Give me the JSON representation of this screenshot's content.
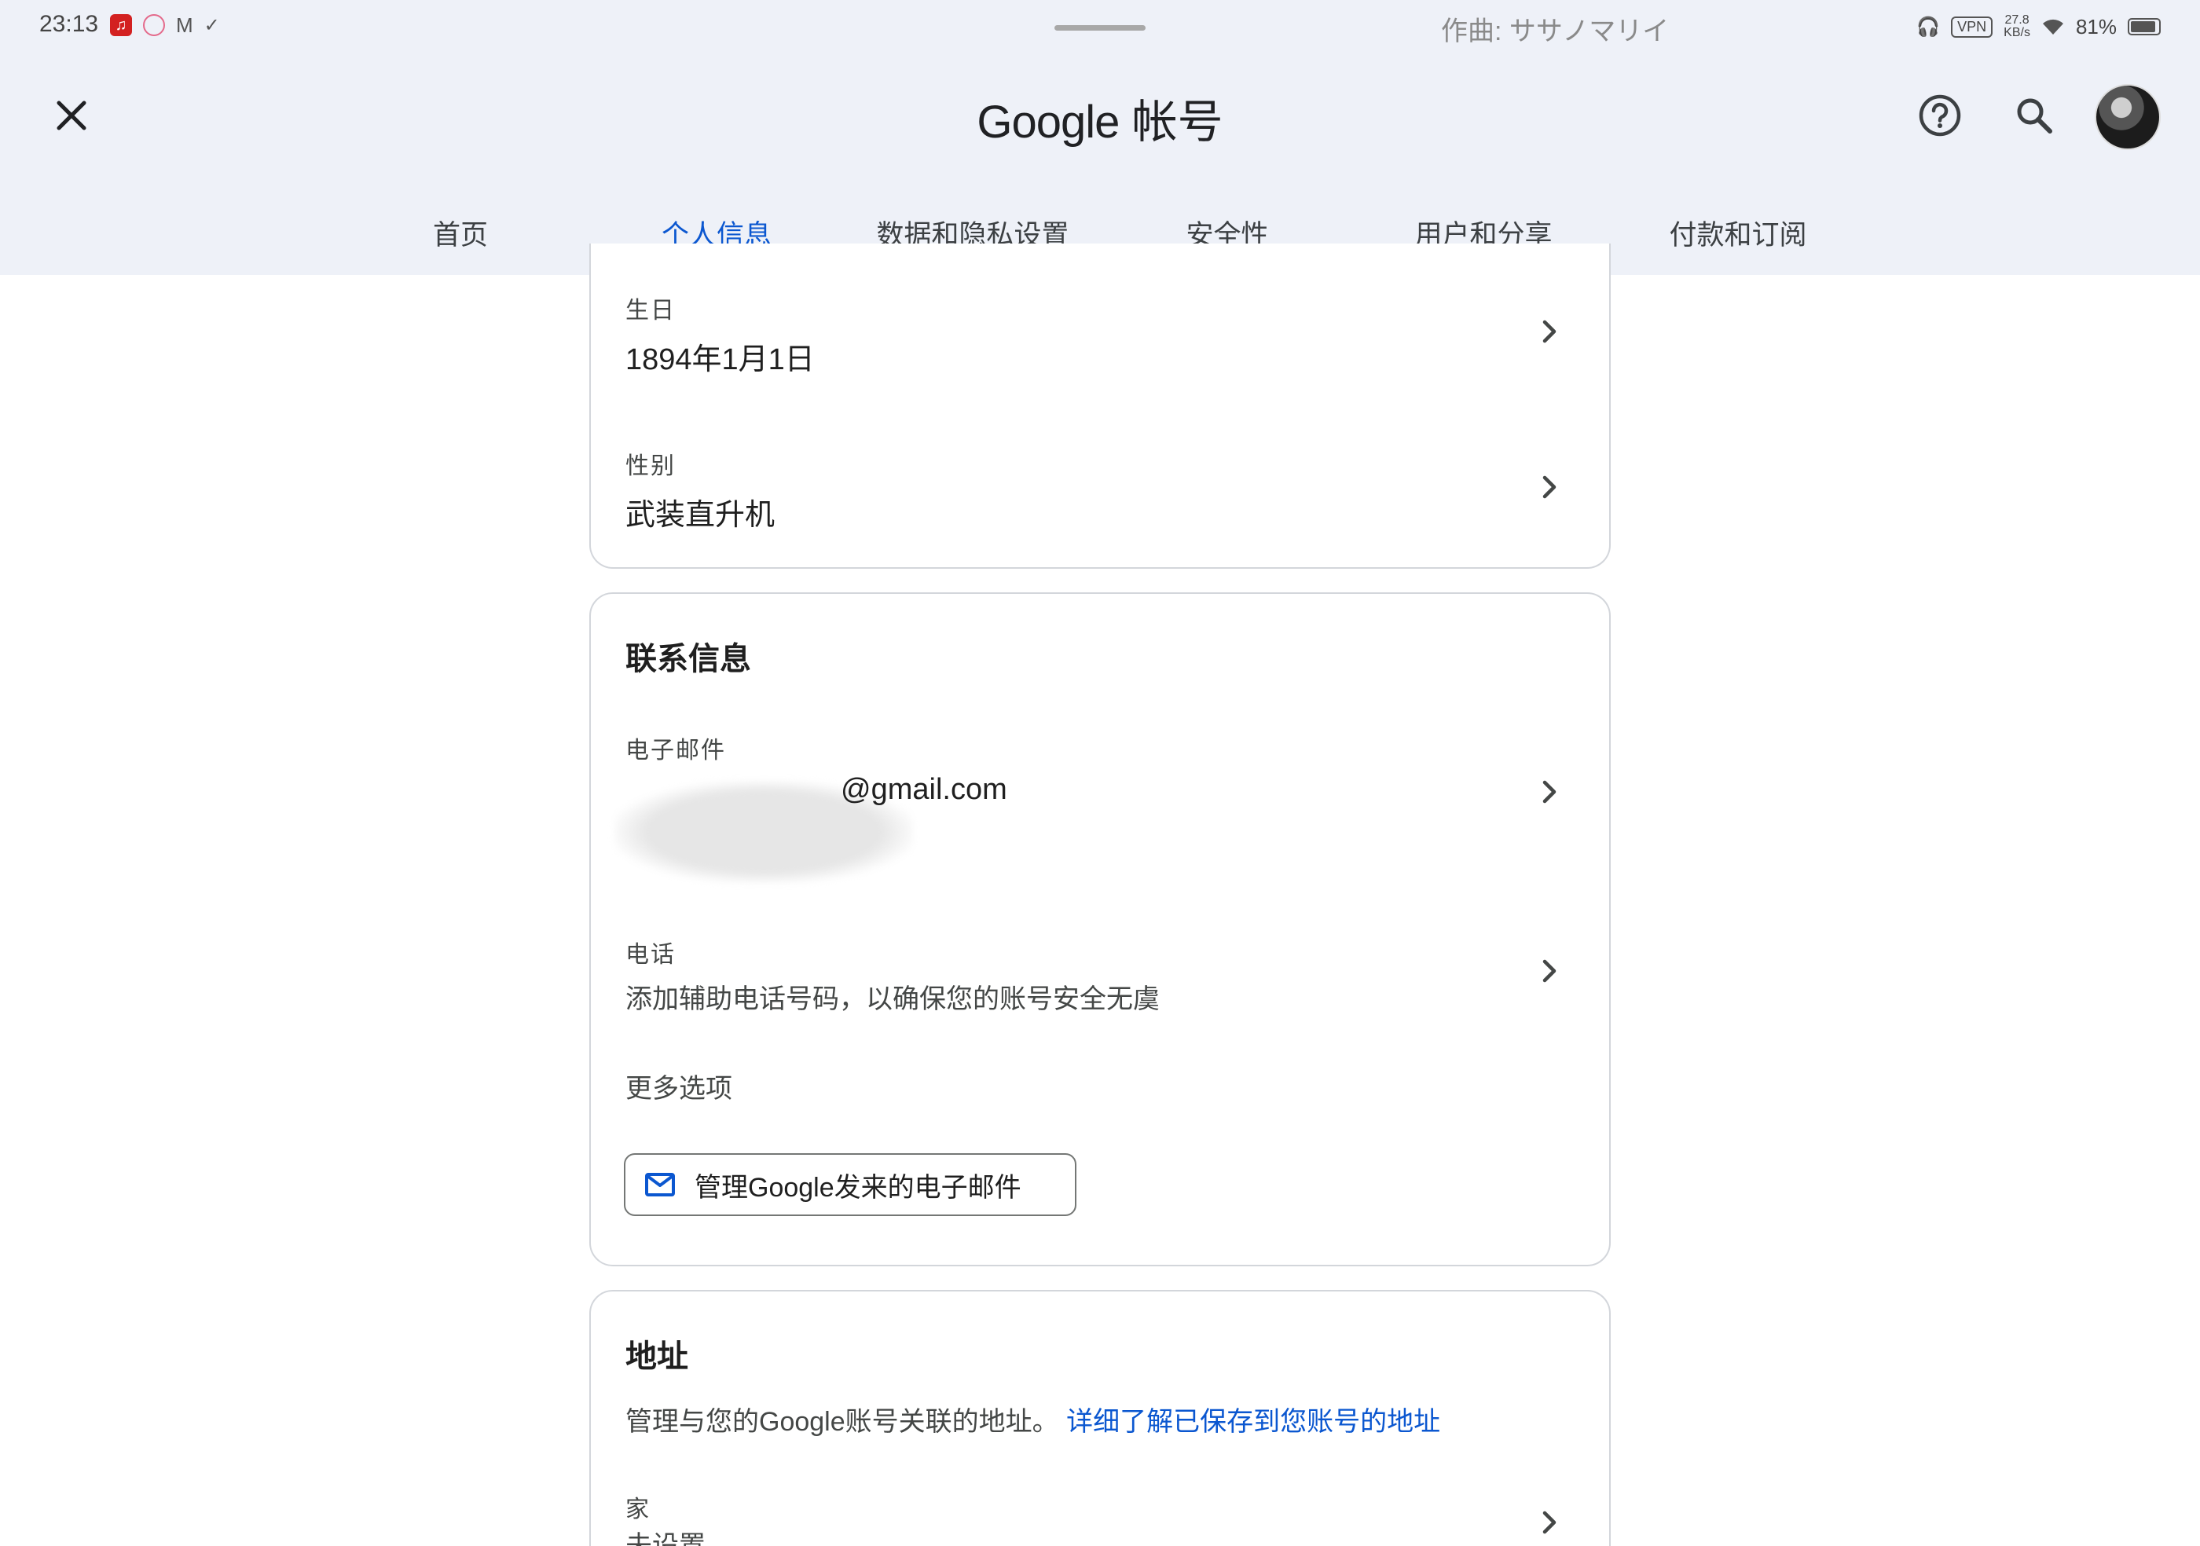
{
  "status_bar": {
    "time": "23:13",
    "now_playing": "作曲: ササノマリイ",
    "vpn": "VPN",
    "speed_value": "27.8",
    "speed_unit": "KB/s",
    "battery": "81%",
    "battery_level": 0.81
  },
  "header": {
    "brand": "Google",
    "title": "帐号"
  },
  "tabs": [
    {
      "label": "首页",
      "active": false
    },
    {
      "label": "个人信息",
      "active": true
    },
    {
      "label": "数据和隐私设置",
      "active": false
    },
    {
      "label": "安全性",
      "active": false
    },
    {
      "label": "用户和分享",
      "active": false
    },
    {
      "label": "付款和订阅",
      "active": false
    }
  ],
  "basic_info": {
    "birthday": {
      "label": "生日",
      "value": "1894年1月1日"
    },
    "gender": {
      "label": "性别",
      "value": "武装直升机"
    }
  },
  "contact": {
    "title": "联系信息",
    "email": {
      "label": "电子邮件",
      "value": "@gmail.com"
    },
    "phone": {
      "label": "电话",
      "value": "添加辅助电话号码，以确保您的账号安全无虞"
    },
    "more_options": "更多选项",
    "manage_button": "管理Google发来的电子邮件"
  },
  "address": {
    "title": "地址",
    "description": "管理与您的Google账号关联的地址。",
    "link": "详细了解已保存到您账号的地址",
    "home": {
      "label": "家",
      "value": "未设置"
    }
  },
  "colors": {
    "accent": "#0b57d0",
    "header_bg": "#eef1f8",
    "card_border": "#d3d6db"
  }
}
